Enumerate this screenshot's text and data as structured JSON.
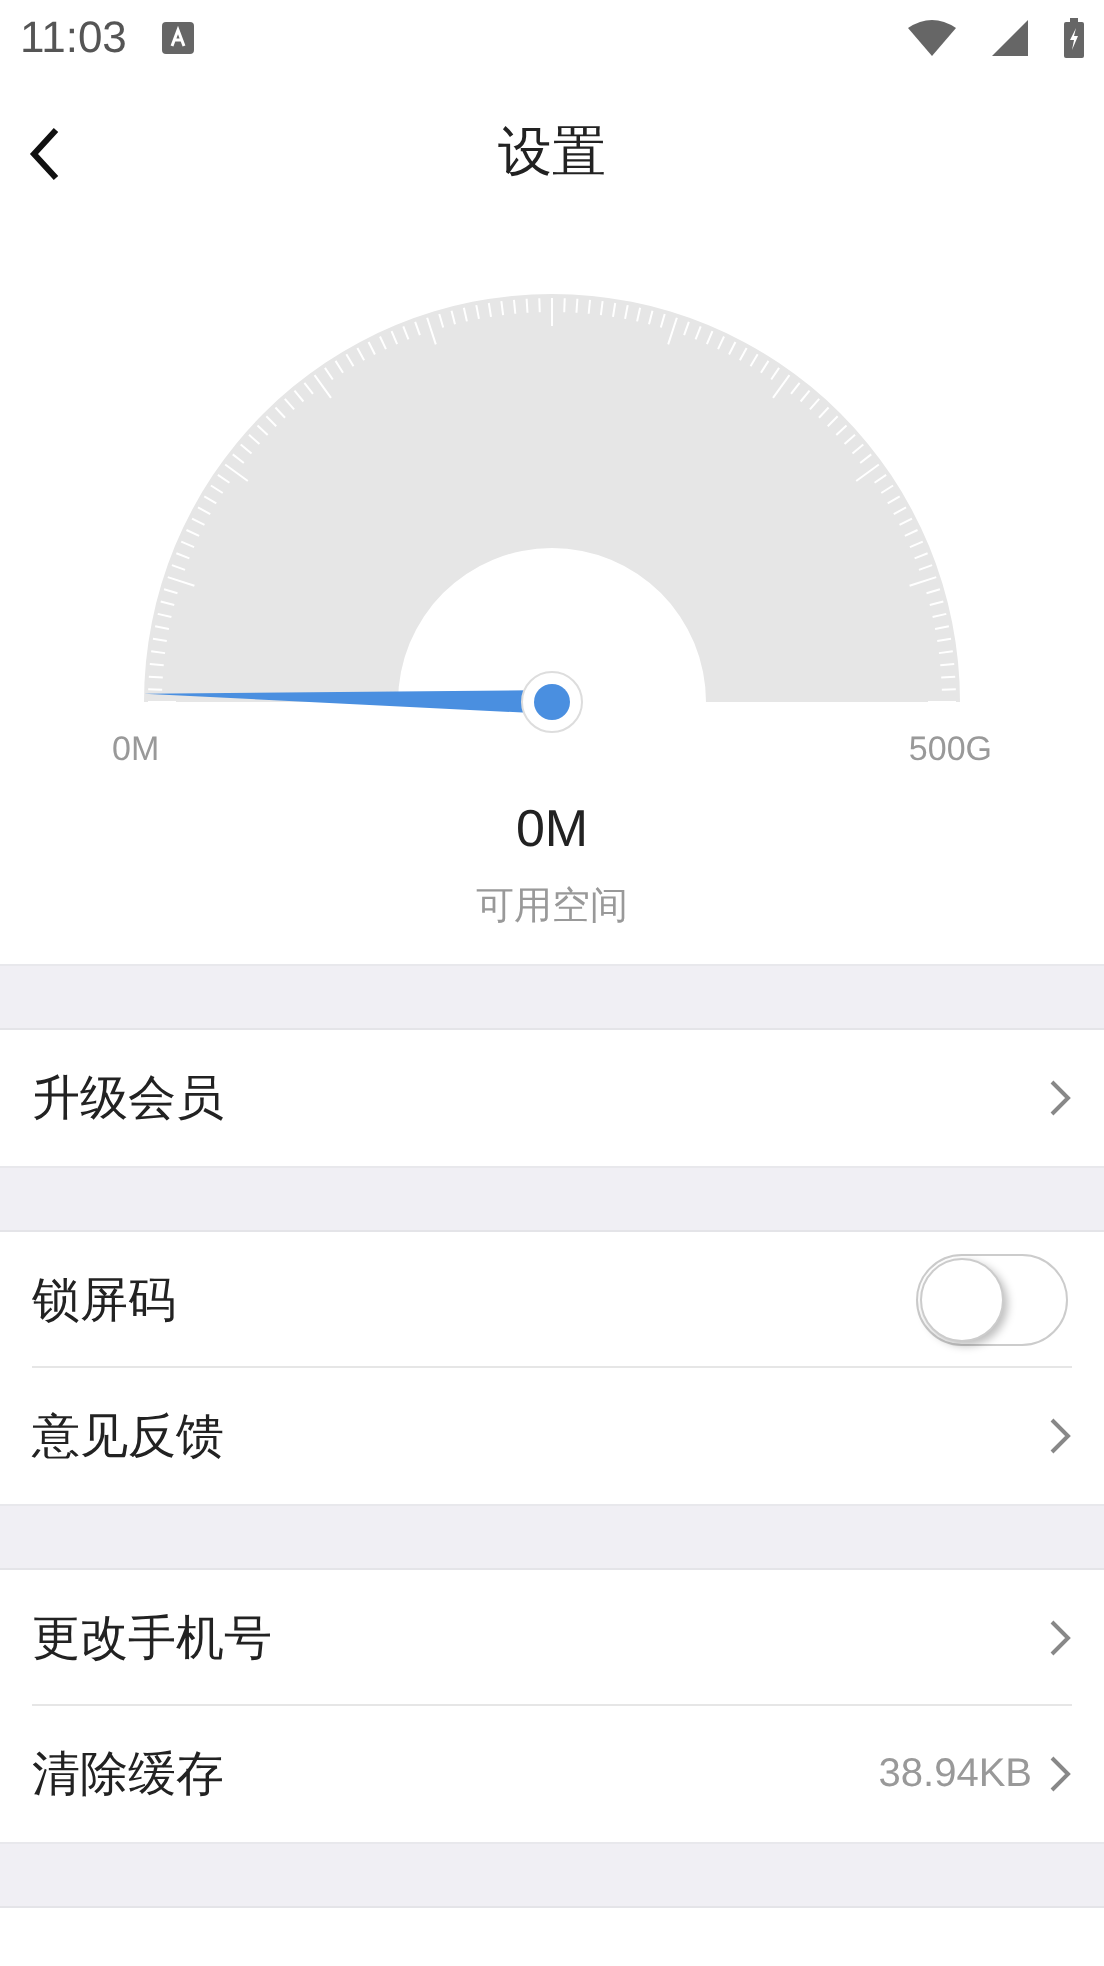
{
  "status_bar": {
    "time": "11:03"
  },
  "header": {
    "title": "设置"
  },
  "gauge": {
    "min_label": "0M",
    "max_label": "500G",
    "value": "0M",
    "caption": "可用空间"
  },
  "groups": [
    {
      "rows": [
        {
          "kind": "link",
          "label": "升级会员"
        }
      ]
    },
    {
      "rows": [
        {
          "kind": "toggle",
          "label": "锁屏码",
          "on": false
        },
        {
          "kind": "link",
          "label": "意见反馈"
        }
      ]
    },
    {
      "rows": [
        {
          "kind": "link",
          "label": "更改手机号"
        },
        {
          "kind": "link",
          "label": "清除缓存",
          "value": "38.94KB"
        }
      ]
    }
  ]
}
